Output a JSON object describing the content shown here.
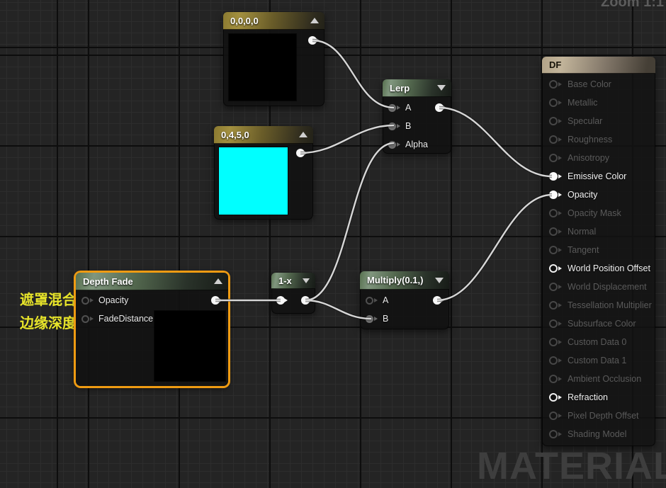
{
  "canvas": {
    "zoom_label": "Zoom 1:1",
    "watermark": "MATERIAL"
  },
  "annotations": {
    "line1": "遮罩混合",
    "line2": "边缘深度"
  },
  "colors": {
    "selection_orange": "#ef9b12",
    "wire": "#d6d6d6",
    "annotation_yellow": "#e8e52a",
    "preview_black": "#000000",
    "preview_cyan": "#00ffff"
  },
  "nodes": {
    "const_black": {
      "title": "0,0,0,0",
      "preview_color": "#000000"
    },
    "const_cyan": {
      "title": "0,4,5,0",
      "preview_color": "#00ffff"
    },
    "lerp": {
      "title": "Lerp",
      "pins": [
        "A",
        "B",
        "Alpha"
      ]
    },
    "depth_fade": {
      "title": "Depth Fade",
      "pins": [
        "Opacity",
        "FadeDistance"
      ],
      "preview_color": "#000000"
    },
    "one_minus_x": {
      "title": "1-x"
    },
    "multiply": {
      "title": "Multiply(0.1,)",
      "pins": [
        "A",
        "B"
      ]
    },
    "material": {
      "title": "DF",
      "pins": [
        {
          "label": "Base Color",
          "state": "disabled"
        },
        {
          "label": "Metallic",
          "state": "disabled"
        },
        {
          "label": "Specular",
          "state": "disabled"
        },
        {
          "label": "Roughness",
          "state": "disabled"
        },
        {
          "label": "Anisotropy",
          "state": "disabled"
        },
        {
          "label": "Emissive Color",
          "state": "connected"
        },
        {
          "label": "Opacity",
          "state": "connected"
        },
        {
          "label": "Opacity Mask",
          "state": "disabled"
        },
        {
          "label": "Normal",
          "state": "disabled"
        },
        {
          "label": "Tangent",
          "state": "disabled"
        },
        {
          "label": "World Position Offset",
          "state": "active"
        },
        {
          "label": "World Displacement",
          "state": "disabled"
        },
        {
          "label": "Tessellation Multiplier",
          "state": "disabled"
        },
        {
          "label": "Subsurface Color",
          "state": "disabled"
        },
        {
          "label": "Custom Data 0",
          "state": "disabled"
        },
        {
          "label": "Custom Data 1",
          "state": "disabled"
        },
        {
          "label": "Ambient Occlusion",
          "state": "disabled"
        },
        {
          "label": "Refraction",
          "state": "active"
        },
        {
          "label": "Pixel Depth Offset",
          "state": "disabled"
        },
        {
          "label": "Shading Model",
          "state": "disabled"
        }
      ]
    }
  }
}
